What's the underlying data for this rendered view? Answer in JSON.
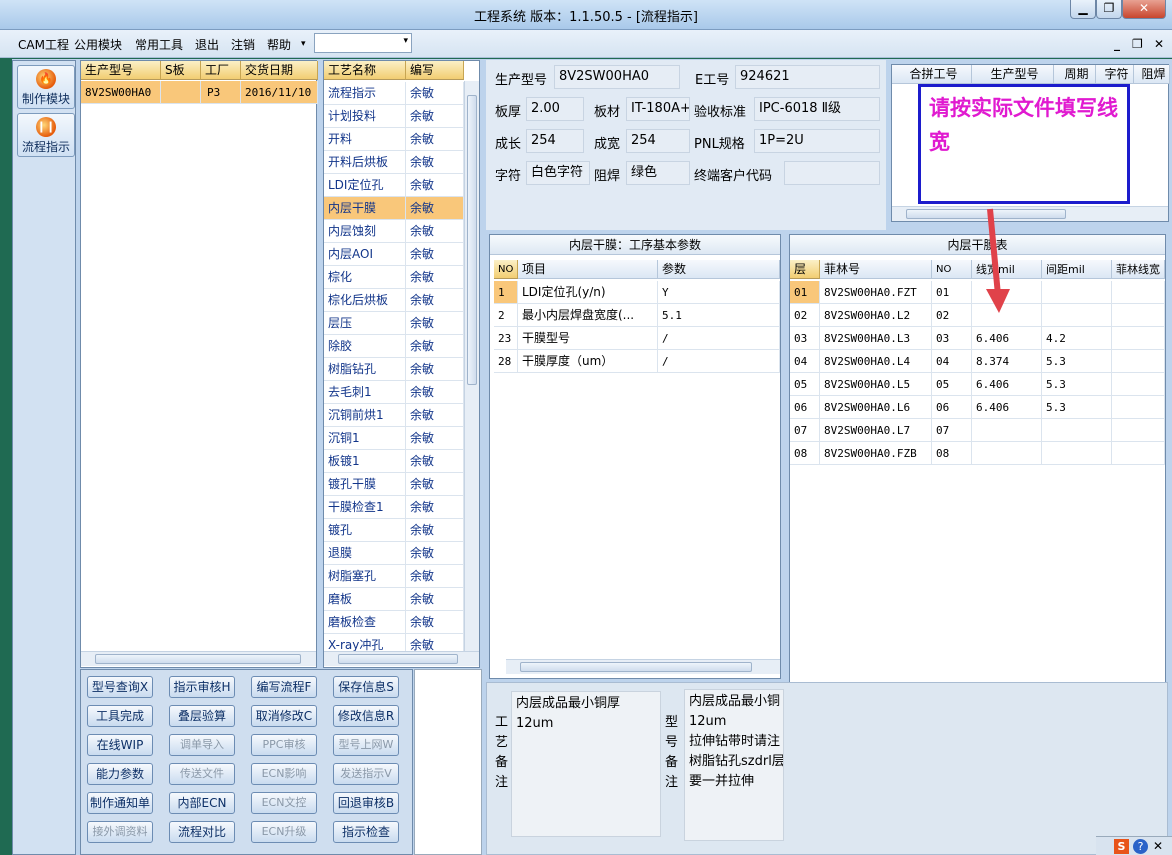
{
  "window": {
    "title": "工程系统  版本：1.1.50.5 - [流程指示]",
    "min": "▁",
    "restore": "❐",
    "close": "✕"
  },
  "menu": {
    "items": [
      "CAM工程",
      "公用模块",
      "常用工具",
      "退出",
      "注销",
      "帮助"
    ],
    "dropdown_arrow": "▾",
    "mdi": [
      "_",
      "❐",
      "✕"
    ]
  },
  "sidebar": {
    "items": [
      {
        "label": "制作模块",
        "icon": "fire-icon"
      },
      {
        "label": "流程指示",
        "icon": "pause-icon"
      }
    ]
  },
  "jobs": {
    "columns": [
      "生产型号",
      "S板",
      "工厂",
      "交货日期"
    ],
    "rows": [
      [
        "8V2SW00HA0",
        "",
        "P3",
        "2016/11/10"
      ]
    ]
  },
  "process": {
    "columns": [
      "工艺名称",
      "编写"
    ],
    "rows": [
      [
        "流程指示",
        "余敏"
      ],
      [
        "计划投料",
        "余敏"
      ],
      [
        "开料",
        "余敏"
      ],
      [
        "开料后烘板",
        "余敏"
      ],
      [
        "LDI定位孔",
        "余敏"
      ],
      [
        "内层干膜",
        "余敏"
      ],
      [
        "内层蚀刻",
        "余敏"
      ],
      [
        "内层AOI",
        "余敏"
      ],
      [
        "棕化",
        "余敏"
      ],
      [
        "棕化后烘板",
        "余敏"
      ],
      [
        "层压",
        "余敏"
      ],
      [
        "除胶",
        "余敏"
      ],
      [
        "树脂钻孔",
        "余敏"
      ],
      [
        "去毛刺1",
        "余敏"
      ],
      [
        "沉铜前烘1",
        "余敏"
      ],
      [
        "沉铜1",
        "余敏"
      ],
      [
        "板镀1",
        "余敏"
      ],
      [
        "镀孔干膜",
        "余敏"
      ],
      [
        "干膜检查1",
        "余敏"
      ],
      [
        "镀孔",
        "余敏"
      ],
      [
        "退膜",
        "余敏"
      ],
      [
        "树脂塞孔",
        "余敏"
      ],
      [
        "磨板",
        "余敏"
      ],
      [
        "磨板检查",
        "余敏"
      ],
      [
        "X-ray冲孔",
        "余敏"
      ]
    ],
    "selected": 5
  },
  "info": {
    "fields": [
      {
        "label": "生产型号",
        "value": "8V2SW00HA0"
      },
      {
        "label": "E工号",
        "value": "924621"
      },
      {
        "label": "板厚",
        "value": "2.00"
      },
      {
        "label": "板材",
        "value": "IT-180A+"
      },
      {
        "label": "验收标准",
        "value": "IPC-6018 Ⅱ级"
      },
      {
        "label": "成长",
        "value": "254"
      },
      {
        "label": "成宽",
        "value": "254"
      },
      {
        "label": "PNL规格",
        "value": "1P=2U"
      },
      {
        "label": "字符",
        "value": "白色字符"
      },
      {
        "label": "阻焊",
        "value": "绿色"
      },
      {
        "label": "终端客户代码",
        "value": ""
      }
    ]
  },
  "merge": {
    "columns": [
      "合拼工号",
      "生产型号",
      "周期",
      "字符",
      "阻焊"
    ]
  },
  "annotation": {
    "text": "请按实际文件填写线宽",
    "color": "#e01ad0",
    "arrow_color": "#e0424a"
  },
  "params": {
    "title": "内层干膜：工序基本参数",
    "columns": [
      "NO",
      "项目",
      "参数"
    ],
    "rows": [
      [
        "1",
        "LDI定位孔(y/n)",
        "Y"
      ],
      [
        "2",
        "最小内层焊盘宽度(...",
        "5.1"
      ],
      [
        "23",
        "干膜型号",
        "/"
      ],
      [
        "28",
        "干膜厚度（um）",
        "/"
      ]
    ],
    "selected": 0
  },
  "film": {
    "title": "内层干膜表",
    "columns": [
      "层",
      "菲林号",
      "NO",
      "线宽mil",
      "间距mil",
      "菲林线宽"
    ],
    "rows": [
      [
        "01",
        "8V2SW00HA0.FZT",
        "01",
        "",
        "",
        ""
      ],
      [
        "02",
        "8V2SW00HA0.L2",
        "02",
        "",
        "",
        ""
      ],
      [
        "03",
        "8V2SW00HA0.L3",
        "03",
        "6.406",
        "4.2",
        ""
      ],
      [
        "04",
        "8V2SW00HA0.L4",
        "04",
        "8.374",
        "5.3",
        ""
      ],
      [
        "05",
        "8V2SW00HA0.L5",
        "05",
        "6.406",
        "5.3",
        ""
      ],
      [
        "06",
        "8V2SW00HA0.L6",
        "06",
        "6.406",
        "5.3",
        ""
      ],
      [
        "07",
        "8V2SW00HA0.L7",
        "07",
        "",
        "",
        ""
      ],
      [
        "08",
        "8V2SW00HA0.FZB",
        "08",
        "",
        "",
        ""
      ]
    ],
    "selected": 0
  },
  "buttons": [
    [
      {
        "label": "型号查询X",
        "enabled": true
      },
      {
        "label": "指示审核H",
        "enabled": true
      },
      {
        "label": "编写流程F",
        "enabled": true
      },
      {
        "label": "保存信息S",
        "enabled": true
      }
    ],
    [
      {
        "label": "工具完成",
        "enabled": true
      },
      {
        "label": "叠层验算",
        "enabled": true
      },
      {
        "label": "取消修改C",
        "enabled": true
      },
      {
        "label": "修改信息R",
        "enabled": true
      }
    ],
    [
      {
        "label": "在线WIP",
        "enabled": true
      },
      {
        "label": "调单导入",
        "enabled": false
      },
      {
        "label": "PPC审核",
        "enabled": false
      },
      {
        "label": "型号上网W",
        "enabled": false
      }
    ],
    [
      {
        "label": "能力参数",
        "enabled": true
      },
      {
        "label": "传送文件",
        "enabled": false
      },
      {
        "label": "ECN影响",
        "enabled": false
      },
      {
        "label": "发送指示V",
        "enabled": false
      }
    ],
    [
      {
        "label": "制作通知单",
        "enabled": true
      },
      {
        "label": "内部ECN",
        "enabled": true
      },
      {
        "label": "ECN文控",
        "enabled": false
      },
      {
        "label": "回退审核B",
        "enabled": true
      }
    ],
    [
      {
        "label": "接外调资料",
        "enabled": false
      },
      {
        "label": "流程对比",
        "enabled": true
      },
      {
        "label": "ECN升级",
        "enabled": false
      },
      {
        "label": "指示检查",
        "enabled": true
      }
    ]
  ],
  "remarks": {
    "craft_label": "工艺备注",
    "craft_text": "内层成品最小铜厚\n12um",
    "model_label": "型号备注",
    "model_text": "内层成品最小铜\n12um\n拉伸钻带时请注\n树脂钻孔szdrl层\n要一并拉伸"
  },
  "tray": {
    "icons": [
      "S",
      "?",
      "✕"
    ]
  }
}
